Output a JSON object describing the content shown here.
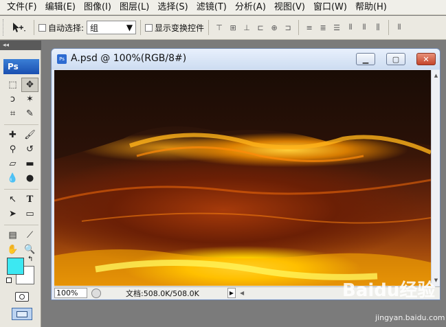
{
  "menu": [
    "文件(F)",
    "编辑(E)",
    "图像(I)",
    "图层(L)",
    "选择(S)",
    "滤镜(T)",
    "分析(A)",
    "视图(V)",
    "窗口(W)",
    "帮助(H)"
  ],
  "options": {
    "auto_select_label": "自动选择:",
    "auto_select_value": "组",
    "show_transform_label": "显示变换控件"
  },
  "toolbox": {
    "logo": "Ps",
    "foreground_color": "#3ce8f2",
    "background_color": "#ffffff"
  },
  "document": {
    "title": "A.psd @ 100%(RGB/8#)",
    "zoom": "100%",
    "doc_info": "文档:508.0K/508.0K"
  },
  "watermark": {
    "brand": "Baidu经验",
    "url": "jingyan.baidu.com"
  }
}
